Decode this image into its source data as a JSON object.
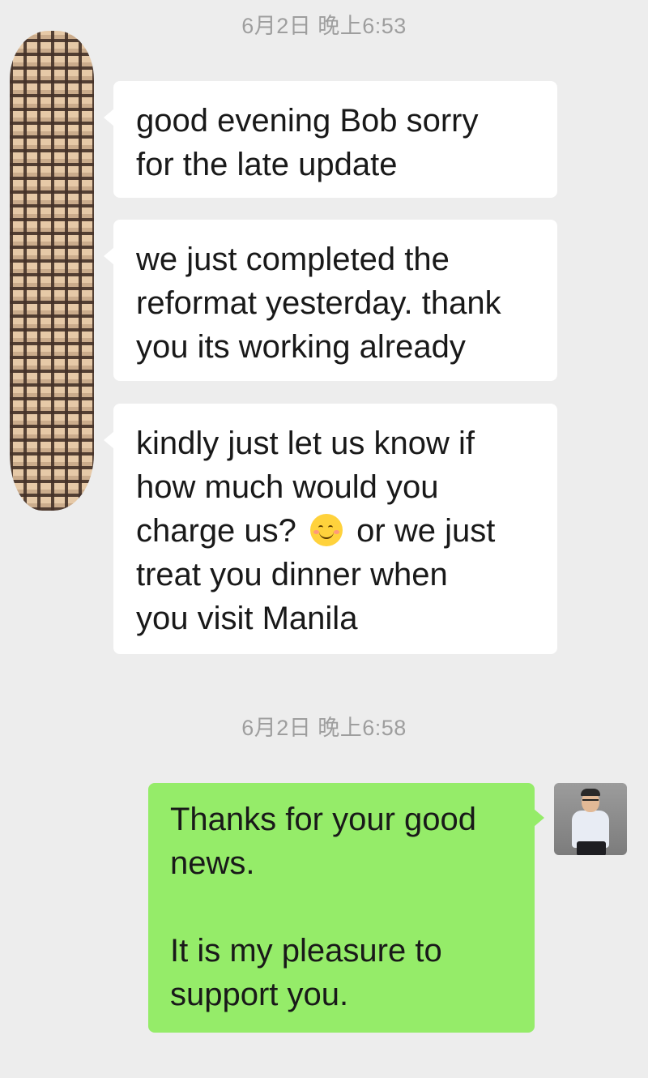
{
  "chat": {
    "timestamps": [
      "6月2日 晚上6:53",
      "6月2日 晚上6:58"
    ],
    "incoming": [
      {
        "text": "good evening Bob sorry\nfor the late update"
      },
      {
        "text": "we just completed the\nreformat yesterday. thank\nyou its working already"
      },
      {
        "text_before": "kindly just let us know if\nhow much would you\ncharge us? ",
        "emoji": "smiling-face-emoji",
        "text_after": " or we just\ntreat you dinner when\nyou visit Manila"
      }
    ],
    "outgoing": [
      {
        "text": "Thanks for your good\nnews.\n\nIt is my pleasure to\nsupport you."
      }
    ]
  },
  "colors": {
    "background": "#ededed",
    "incoming_bubble": "#ffffff",
    "outgoing_bubble": "#95ec69",
    "timestamp_text": "#9e9e9e"
  },
  "icons": {
    "contact_avatar": "redacted-avatar",
    "my_avatar": "user-photo-avatar",
    "emoji": "smiling-face-emoji"
  }
}
